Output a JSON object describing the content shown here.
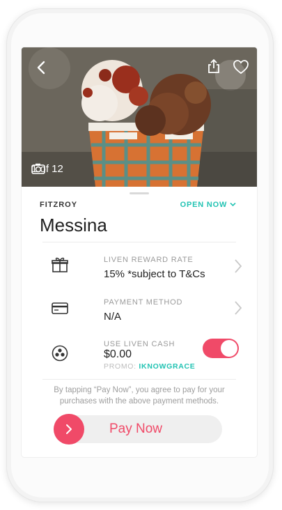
{
  "venue": {
    "suburb": "FITZROY",
    "status": "OPEN NOW",
    "name": "Messina",
    "photo_counter": "1 of 12"
  },
  "rows": {
    "reward_label": "LIVEN REWARD RATE",
    "reward_value": "15% *subject to T&Cs",
    "payment_label": "PAYMENT METHOD",
    "payment_value": "N/A",
    "cash_label": "USE LIVEN CASH",
    "cash_value": "$0.00",
    "promo_label": "PROMO:",
    "promo_code": "IKNOWGRACE",
    "cash_toggle_on": true
  },
  "terms": "By tapping “Pay Now”, you agree to pay for your purchases with the above payment methods.",
  "pay_button": "Pay Now",
  "icons": [
    "back-icon",
    "share-icon",
    "heart-icon",
    "camera-icon",
    "chevron-down-icon",
    "gift-icon",
    "card-icon",
    "liven-cash-icon",
    "chevron-right-icon",
    "arrow-right-icon"
  ],
  "colors": {
    "accent": "#f04a68",
    "teal": "#22c3b3"
  }
}
